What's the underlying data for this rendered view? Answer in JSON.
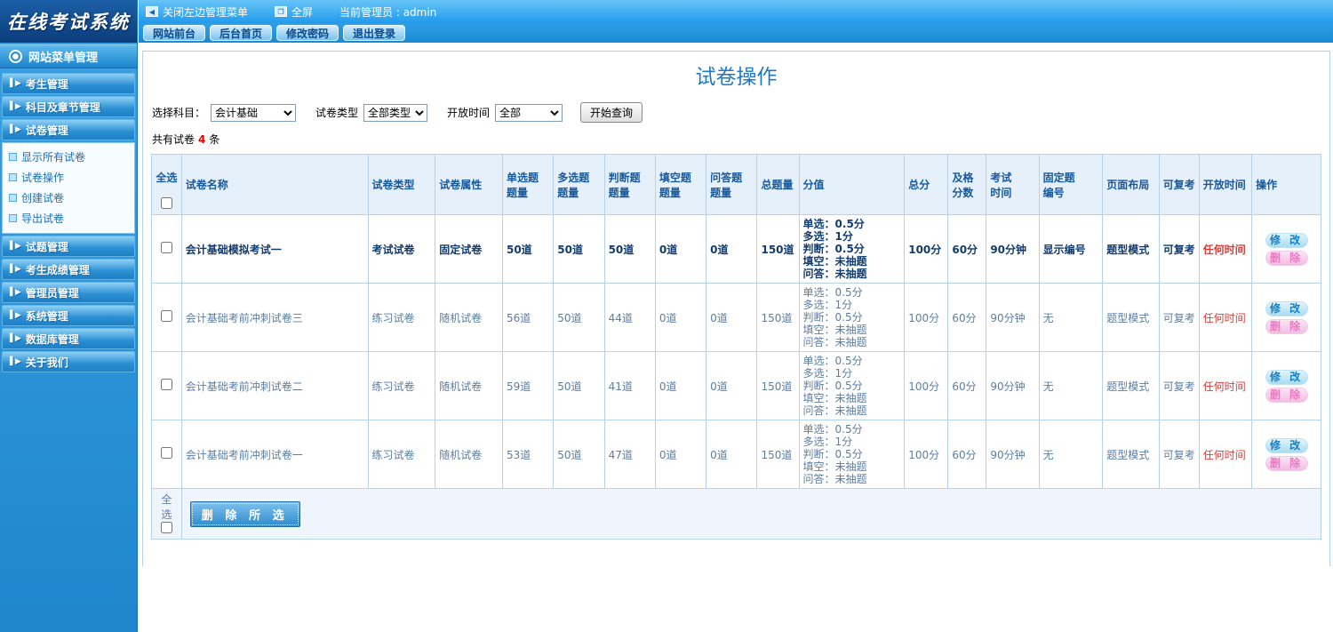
{
  "logo": {
    "title": "在线考试系统"
  },
  "topbar": {
    "close_menu": "关闭左边管理菜单",
    "fullscreen": "全屏",
    "admin_label": "当前管理员 : admin",
    "tabs": [
      "网站前台",
      "后台首页",
      "修改密码",
      "退出登录"
    ]
  },
  "sidebar": {
    "title": "网站菜单管理",
    "items": [
      {
        "label": "考生管理"
      },
      {
        "label": "科目及章节管理"
      },
      {
        "label": "试卷管理",
        "children": [
          "显示所有试卷",
          "试卷操作",
          "创建试卷",
          "导出试卷"
        ]
      },
      {
        "label": "试题管理"
      },
      {
        "label": "考生成绩管理"
      },
      {
        "label": "管理员管理"
      },
      {
        "label": "系统管理"
      },
      {
        "label": "数据库管理"
      },
      {
        "label": "关于我们"
      }
    ]
  },
  "main": {
    "title": "试卷操作",
    "filters": {
      "subject_label": "选择科目：",
      "subject_value": "会计基础",
      "type_label": "试卷类型",
      "type_value": "全部类型",
      "time_label": "开放时间",
      "time_value": "全部",
      "search_button": "开始查询"
    },
    "count": {
      "prefix": "共有试卷",
      "number": "4",
      "suffix": "条"
    },
    "table": {
      "headers": [
        "全选",
        "试卷名称",
        "试卷类型",
        "试卷属性",
        "单选题\n题量",
        "多选题\n题量",
        "判断题\n题量",
        "填空题\n题量",
        "问答题\n题量",
        "总题量",
        "分值",
        "总分",
        "及格\n分数",
        "考试\n时间",
        "固定题\n编号",
        "页面布局",
        "可复考",
        "开放时间",
        "操作"
      ],
      "actions": {
        "edit": "修 改",
        "delete": "删 除"
      },
      "rows": [
        {
          "emphasis": true,
          "name": "会计基础模拟考试一",
          "type": "考试试卷",
          "attr": "固定试卷",
          "single": "50道",
          "multi": "50道",
          "judge": "50道",
          "blank": "0道",
          "qa": "0道",
          "total": "150道",
          "scores": [
            "单选：0.5分",
            "多选：1分",
            "判断：0.5分",
            "填空：未抽题",
            "问答：未抽题"
          ],
          "total_score": "100分",
          "pass_score": "60分",
          "duration": "90分钟",
          "fixed_no": "显示编号",
          "layout": "题型模式",
          "retake": "可复考",
          "open_time": "任何时间"
        },
        {
          "emphasis": false,
          "name": "会计基础考前冲刺试卷三",
          "type": "练习试卷",
          "attr": "随机试卷",
          "single": "56道",
          "multi": "50道",
          "judge": "44道",
          "blank": "0道",
          "qa": "0道",
          "total": "150道",
          "scores": [
            "单选：0.5分",
            "多选：1分",
            "判断：0.5分",
            "填空：未抽题",
            "问答：未抽题"
          ],
          "total_score": "100分",
          "pass_score": "60分",
          "duration": "90分钟",
          "fixed_no": "无",
          "layout": "题型模式",
          "retake": "可复考",
          "open_time": "任何时间"
        },
        {
          "emphasis": false,
          "name": "会计基础考前冲刺试卷二",
          "type": "练习试卷",
          "attr": "随机试卷",
          "single": "59道",
          "multi": "50道",
          "judge": "41道",
          "blank": "0道",
          "qa": "0道",
          "total": "150道",
          "scores": [
            "单选：0.5分",
            "多选：1分",
            "判断：0.5分",
            "填空：未抽题",
            "问答：未抽题"
          ],
          "total_score": "100分",
          "pass_score": "60分",
          "duration": "90分钟",
          "fixed_no": "无",
          "layout": "题型模式",
          "retake": "可复考",
          "open_time": "任何时间"
        },
        {
          "emphasis": false,
          "name": "会计基础考前冲刺试卷一",
          "type": "练习试卷",
          "attr": "随机试卷",
          "single": "53道",
          "multi": "50道",
          "judge": "47道",
          "blank": "0道",
          "qa": "0道",
          "total": "150道",
          "scores": [
            "单选：0.5分",
            "多选：1分",
            "判断：0.5分",
            "填空：未抽题",
            "问答：未抽题"
          ],
          "total_score": "100分",
          "pass_score": "60分",
          "duration": "90分钟",
          "fixed_no": "无",
          "layout": "题型模式",
          "retake": "可复考",
          "open_time": "任何时间"
        }
      ]
    },
    "footer": {
      "select_all": "全选",
      "delete_button": "删 除 所 选"
    }
  }
}
